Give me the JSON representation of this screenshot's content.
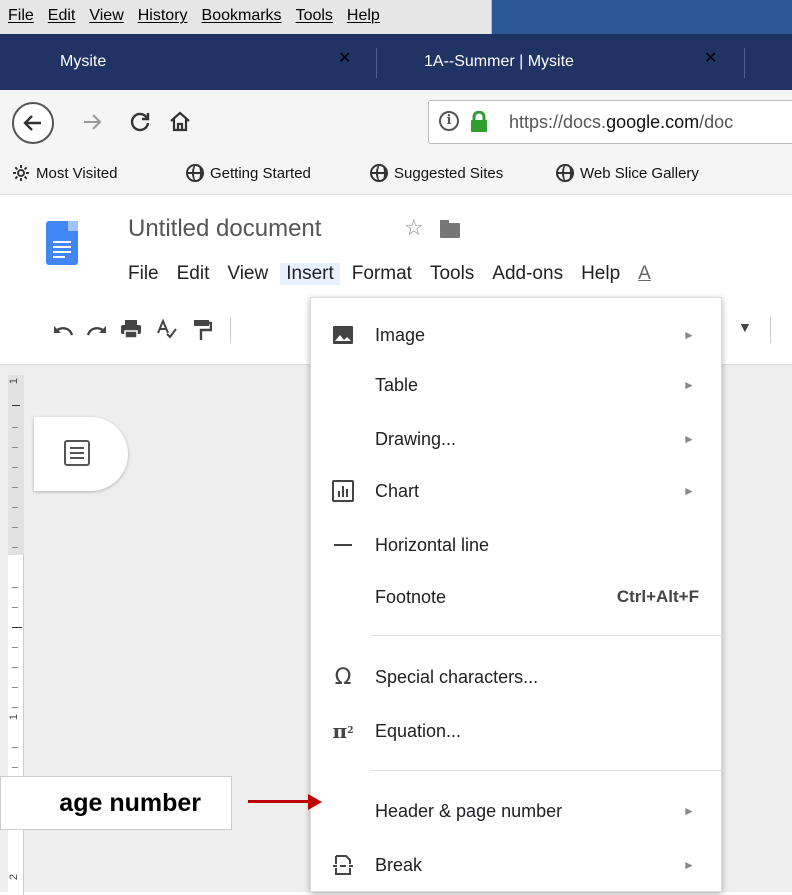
{
  "browser": {
    "menus": [
      "File",
      "Edit",
      "View",
      "History",
      "Bookmarks",
      "Tools",
      "Help"
    ],
    "tabs": [
      {
        "title": "Mysite"
      },
      {
        "title": "1A--Summer | Mysite"
      }
    ],
    "close_glyph": "✕",
    "url_prefix": "https://docs.",
    "url_domain": "google.com",
    "url_suffix": "/doc",
    "bookmarks": [
      "Most Visited",
      "Getting Started",
      "Suggested Sites",
      "Web Slice Gallery"
    ]
  },
  "docs": {
    "title": "Untitled document",
    "menus": [
      "File",
      "Edit",
      "View",
      "Insert",
      "Format",
      "Tools",
      "Add-ons",
      "Help"
    ],
    "active_menu": "Insert",
    "menu_overflow": "A"
  },
  "ruler": {
    "marks": [
      "1",
      "1",
      "2"
    ]
  },
  "insert_menu": {
    "items": [
      {
        "label": "Image",
        "icon": "image-icon",
        "submenu": true
      },
      {
        "label": "Table",
        "icon": "",
        "submenu": true
      },
      {
        "label": "Drawing...",
        "icon": "",
        "submenu": true
      },
      {
        "label": "Chart",
        "icon": "chart-icon",
        "submenu": true
      },
      {
        "label": "Horizontal line",
        "icon": "horizontal-line-icon",
        "submenu": false
      },
      {
        "label": "Footnote",
        "icon": "",
        "shortcut": "Ctrl+Alt+F",
        "submenu": false
      },
      {
        "label": "Special characters...",
        "icon": "omega-icon",
        "submenu": false
      },
      {
        "label": "Equation...",
        "icon": "pi-icon",
        "submenu": false
      },
      {
        "label": "Header & page number",
        "icon": "",
        "submenu": true
      },
      {
        "label": "Break",
        "icon": "break-icon",
        "submenu": true
      }
    ],
    "submenu_arrow": "►"
  },
  "annotation": {
    "text": "age number",
    "arrow_color": "#c00000"
  },
  "colors": {
    "menubar_blue": "#2b5797",
    "tabbar": "#1f3464",
    "docs_blue": "#4285f4",
    "lock_green": "#2e9e2e"
  }
}
